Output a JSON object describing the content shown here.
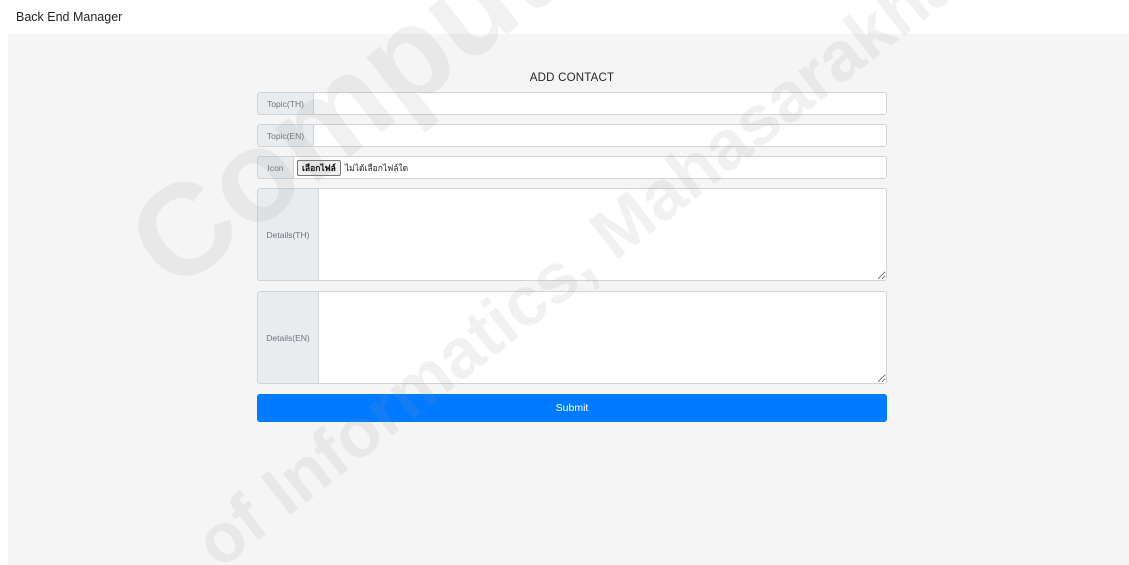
{
  "header": {
    "app_title": "Back End Manager"
  },
  "form": {
    "title": "ADD CONTACT",
    "topic_th": {
      "label": "Topic(TH)",
      "value": "",
      "placeholder": ""
    },
    "topic_en": {
      "label": "Topic(EN)",
      "value": "",
      "placeholder": ""
    },
    "icon": {
      "label": "Icon",
      "choose_button": "เลือกไฟล์",
      "status": "ไม่ได้เลือกไฟล์ใด"
    },
    "details_th": {
      "label": "Details(TH)",
      "value": ""
    },
    "details_en": {
      "label": "Details(EN)",
      "value": ""
    },
    "submit_label": "Submit"
  },
  "watermark": {
    "line1": "Computer Science",
    "line2": "of Informatics, Mahasarakham"
  },
  "colors": {
    "primary": "#007bff",
    "content_bg": "#f5f5f5",
    "addon_bg": "#e9ecef",
    "border": "#ced4da"
  }
}
